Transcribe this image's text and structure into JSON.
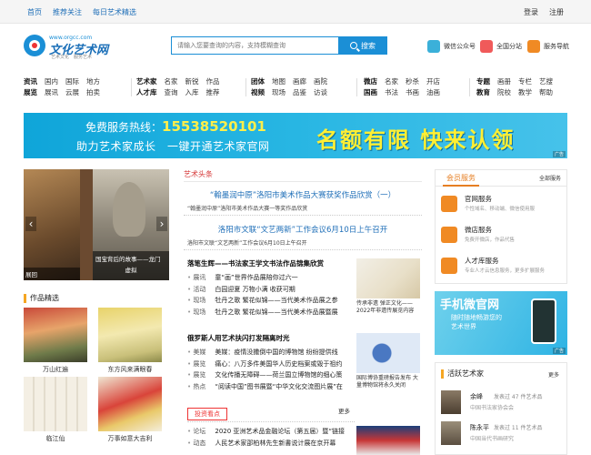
{
  "topbar": {
    "left": [
      "首页",
      "推荐关注",
      "每日艺术精选"
    ],
    "right": [
      "登录",
      "注册"
    ]
  },
  "logo": {
    "domain": "www.orgcc.com",
    "name": "文化艺术网",
    "tagline": "艺术文化　服务艺术"
  },
  "search": {
    "placeholder": "请输入您要查询的内容，支持模糊查询",
    "button": "搜索"
  },
  "header_links": [
    {
      "label": "微信公众号",
      "color": "#3bb0d9"
    },
    {
      "label": "全国分站",
      "color": "#f05a5a"
    },
    {
      "label": "服务导航",
      "color": "#f08a24"
    }
  ],
  "nav": [
    {
      "rows": [
        [
          "资讯",
          "国内",
          "国际",
          "地方"
        ],
        [
          "展览",
          "展讯",
          "云展",
          "拍卖"
        ]
      ]
    },
    {
      "rows": [
        [
          "艺术家",
          "名家",
          "新锐",
          "作品"
        ],
        [
          "人才库",
          "查询",
          "入库",
          "推荐"
        ]
      ]
    },
    {
      "rows": [
        [
          "团体",
          "地图",
          "画廊",
          "画院"
        ],
        [
          "视频",
          "现场",
          "品鉴",
          "访谈"
        ]
      ]
    },
    {
      "rows": [
        [
          "微店",
          "名家",
          "秒杀",
          "开店"
        ],
        [
          "国画",
          "书法",
          "书画",
          "油画"
        ]
      ]
    },
    {
      "rows": [
        [
          "专题",
          "画册",
          "专栏",
          "艺搜"
        ],
        [
          "教育",
          "院校",
          "教学",
          "帮助"
        ]
      ]
    }
  ],
  "banner": {
    "hotline_label": "免费服务热线：",
    "hotline": "15538520101",
    "sub": "助力艺术家成长　一键开通艺术家官网",
    "big": "名额有限 快来认领",
    "ad": "广告"
  },
  "slideshow": {
    "caption_right": "国宝背后的故事——龙门",
    "caption_right2": "虚拟",
    "caption_left": "展回"
  },
  "works": {
    "title": "作品精选",
    "items": [
      "万山红遍",
      "东方风来满眼春",
      "临江仙",
      "万事如意大吉利"
    ]
  },
  "headlines": {
    "title": "艺术头条",
    "h1": "“翰墨润中原”洛阳市美术作品大赛获奖作品欣赏（一）",
    "h1_sub": "“翰墨润中原”洛阳市美术作品大赛一等奖作品欣赏",
    "h2": "洛阳市文联“文艺两新”工作会议6月10日上午召开",
    "h2_sub": "洛阳市文联“文艺两新”工作会议6月10日上午召开"
  },
  "news1": {
    "title": "落笔生辉——书法家王学文书法作品锦集欣赏",
    "items": [
      [
        "展讯",
        "童“画”世界作品展陪你过六一"
      ],
      [
        "活动",
        "白园迎夏 万物小满 收获可期"
      ],
      [
        "现场",
        "牡丹之歌 繁花似锦——当代美术作品展之参"
      ],
      [
        "现场",
        "牡丹之歌 繁花似锦——当代美术作品展暨展"
      ]
    ]
  },
  "news2": {
    "title": "俄罗斯人用艺术扶闪打发隔离时光",
    "items": [
      [
        "美媒",
        "美媒：疫情没撒倒中国的博物馆 纷纷提供线"
      ],
      [
        "展览",
        "痛心：八万多件美国华人历史档案或毁于祖约"
      ],
      [
        "展览",
        "文化传播无障碍——荷兰国立博物馆的细心策"
      ],
      [
        "热点",
        "“阅读中国”图书展暨“中华文化交流图片展”在"
      ]
    ],
    "more": "更多"
  },
  "invest": {
    "title": "投资看点",
    "more": "更多",
    "items": [
      [
        "论坛",
        "2020 亚洲艺术品金融论坛（第五届）暨“链接"
      ],
      [
        "动态",
        "人民艺术家邵柏林先生新書说计展在京开幕"
      ]
    ]
  },
  "thumbs": [
    {
      "caption": "传承非遗 弹正文化——2022年非遗传展览内容"
    },
    {
      "caption": "国际博协重磅报告发布 大量博物馆将永久关闭"
    }
  ],
  "member_services": {
    "tab": "会员服务",
    "guide": "全部服务",
    "items": [
      {
        "title": "官网服务",
        "desc": "个性域名、移动端、微信使用服",
        "color": "#f08a24"
      },
      {
        "title": "微店服务",
        "desc": "免费开微店，作品代售",
        "color": "#f08a24"
      },
      {
        "title": "人才库服务",
        "desc": "专业人才云信息服务，更多扩展服务",
        "color": "#f08a24"
      }
    ]
  },
  "mobile_ad": {
    "title": "手机微官网",
    "line1": "随时随地畅游您的",
    "line2": "艺术世界",
    "ad": "广告"
  },
  "artists": {
    "title": "活跃艺术家",
    "more": "更多",
    "items": [
      {
        "name": "余峰",
        "count": "发表过 47 件艺术品",
        "org": "中国书法家协会会"
      },
      {
        "name": "陈永平",
        "count": "发表过 11 件艺术品",
        "org": "中国当代书画研究"
      }
    ]
  }
}
